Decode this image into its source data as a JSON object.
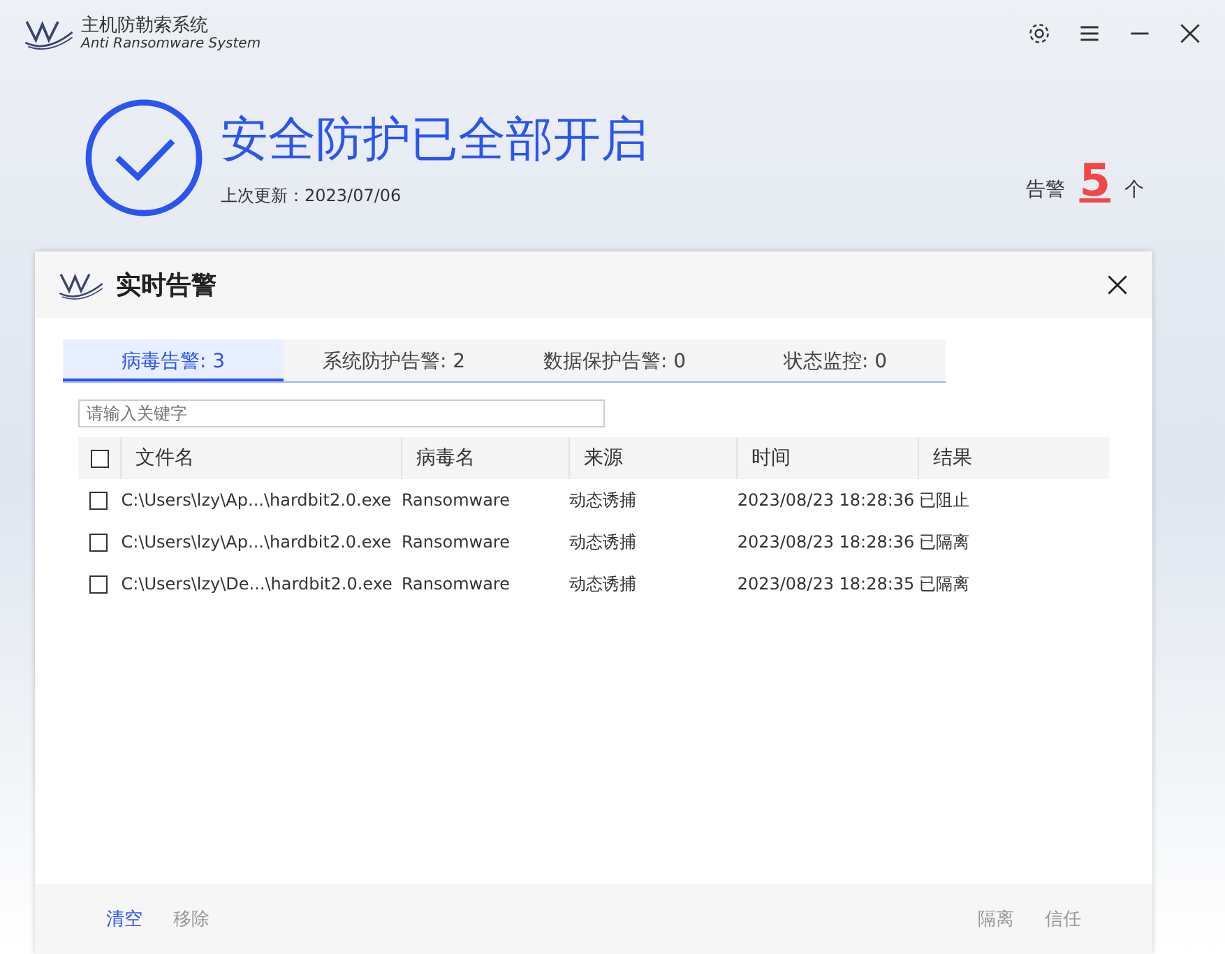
{
  "app": {
    "title": "主机防勒索系统",
    "subtitle": "Anti Ransomware System"
  },
  "status": {
    "headline": "安全防护已全部开启",
    "update": "上次更新：2023/07/06",
    "alert_label": "告警",
    "alert_count": "5",
    "alert_unit": "个"
  },
  "dialog": {
    "title": "实时告警",
    "tabs": [
      {
        "label": "病毒告警: 3",
        "selected": true
      },
      {
        "label": "系统防护告警: 2",
        "selected": false
      },
      {
        "label": "数据保护告警: 0",
        "selected": false
      },
      {
        "label": "状态监控: 0",
        "selected": false
      }
    ],
    "search": {
      "placeholder": "请输入关键字"
    },
    "table": {
      "header_checked": false,
      "columns": [
        "文件名",
        "病毒名",
        "来源",
        "时间",
        "结果"
      ],
      "rows": [
        {
          "checked": false,
          "cells": [
            "C:\\Users\\lzy\\Ap...\\hardbit2.0.exe",
            "Ransomware",
            "动态诱捕",
            "2023/08/23 18:28:36",
            "已阻止"
          ]
        },
        {
          "checked": false,
          "cells": [
            "C:\\Users\\lzy\\Ap...\\hardbit2.0.exe",
            "Ransomware",
            "动态诱捕",
            "2023/08/23 18:28:36",
            "已隔离"
          ]
        },
        {
          "checked": false,
          "cells": [
            "C:\\Users\\lzy\\De...\\hardbit2.0.exe",
            "Ransomware",
            "动态诱捕",
            "2023/08/23 18:28:35",
            "已隔离"
          ]
        }
      ]
    },
    "footer_left": [
      {
        "label": "清空",
        "disabled": false
      },
      {
        "label": "移除",
        "disabled": true
      }
    ],
    "footer_right": [
      {
        "label": "隔离",
        "disabled": true
      },
      {
        "label": "信任",
        "disabled": true
      }
    ]
  }
}
